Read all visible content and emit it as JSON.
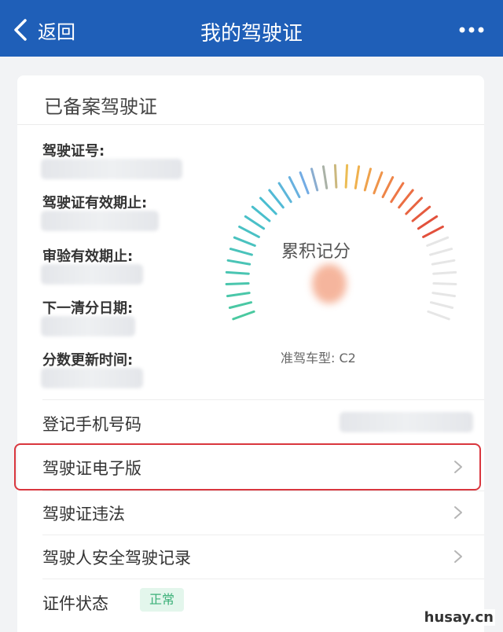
{
  "header": {
    "back_label": "返回",
    "title": "我的驾驶证",
    "bg_color": "#1f5fb8"
  },
  "card": {
    "title": "已备案驾驶证",
    "fields": [
      {
        "label": "驾驶证号:"
      },
      {
        "label": "驾驶证有效期止:"
      },
      {
        "label": "审验有效期止:"
      },
      {
        "label": "下一清分日期:"
      },
      {
        "label": "分数更新时间:"
      }
    ],
    "gauge": {
      "label": "累积记分",
      "vehicle_type": "准驾车型: C2",
      "level_fraction": 1.0
    },
    "phone_label": "登记手机号码",
    "menu": [
      {
        "label": "驾驶证电子版",
        "highlighted": true
      },
      {
        "label": "驾驶证违法",
        "highlighted": false
      },
      {
        "label": "驾驶人安全驾驶记录",
        "highlighted": false
      }
    ],
    "status_label": "证件状态",
    "status_value": "正常",
    "status_color": "#3bb078"
  },
  "icons": {
    "back": "chevron-left-icon",
    "more": "more-dots-icon",
    "row_arrow": "chevron-right-icon"
  },
  "watermark": "husay.cn",
  "highlight_color": "#d9363e"
}
